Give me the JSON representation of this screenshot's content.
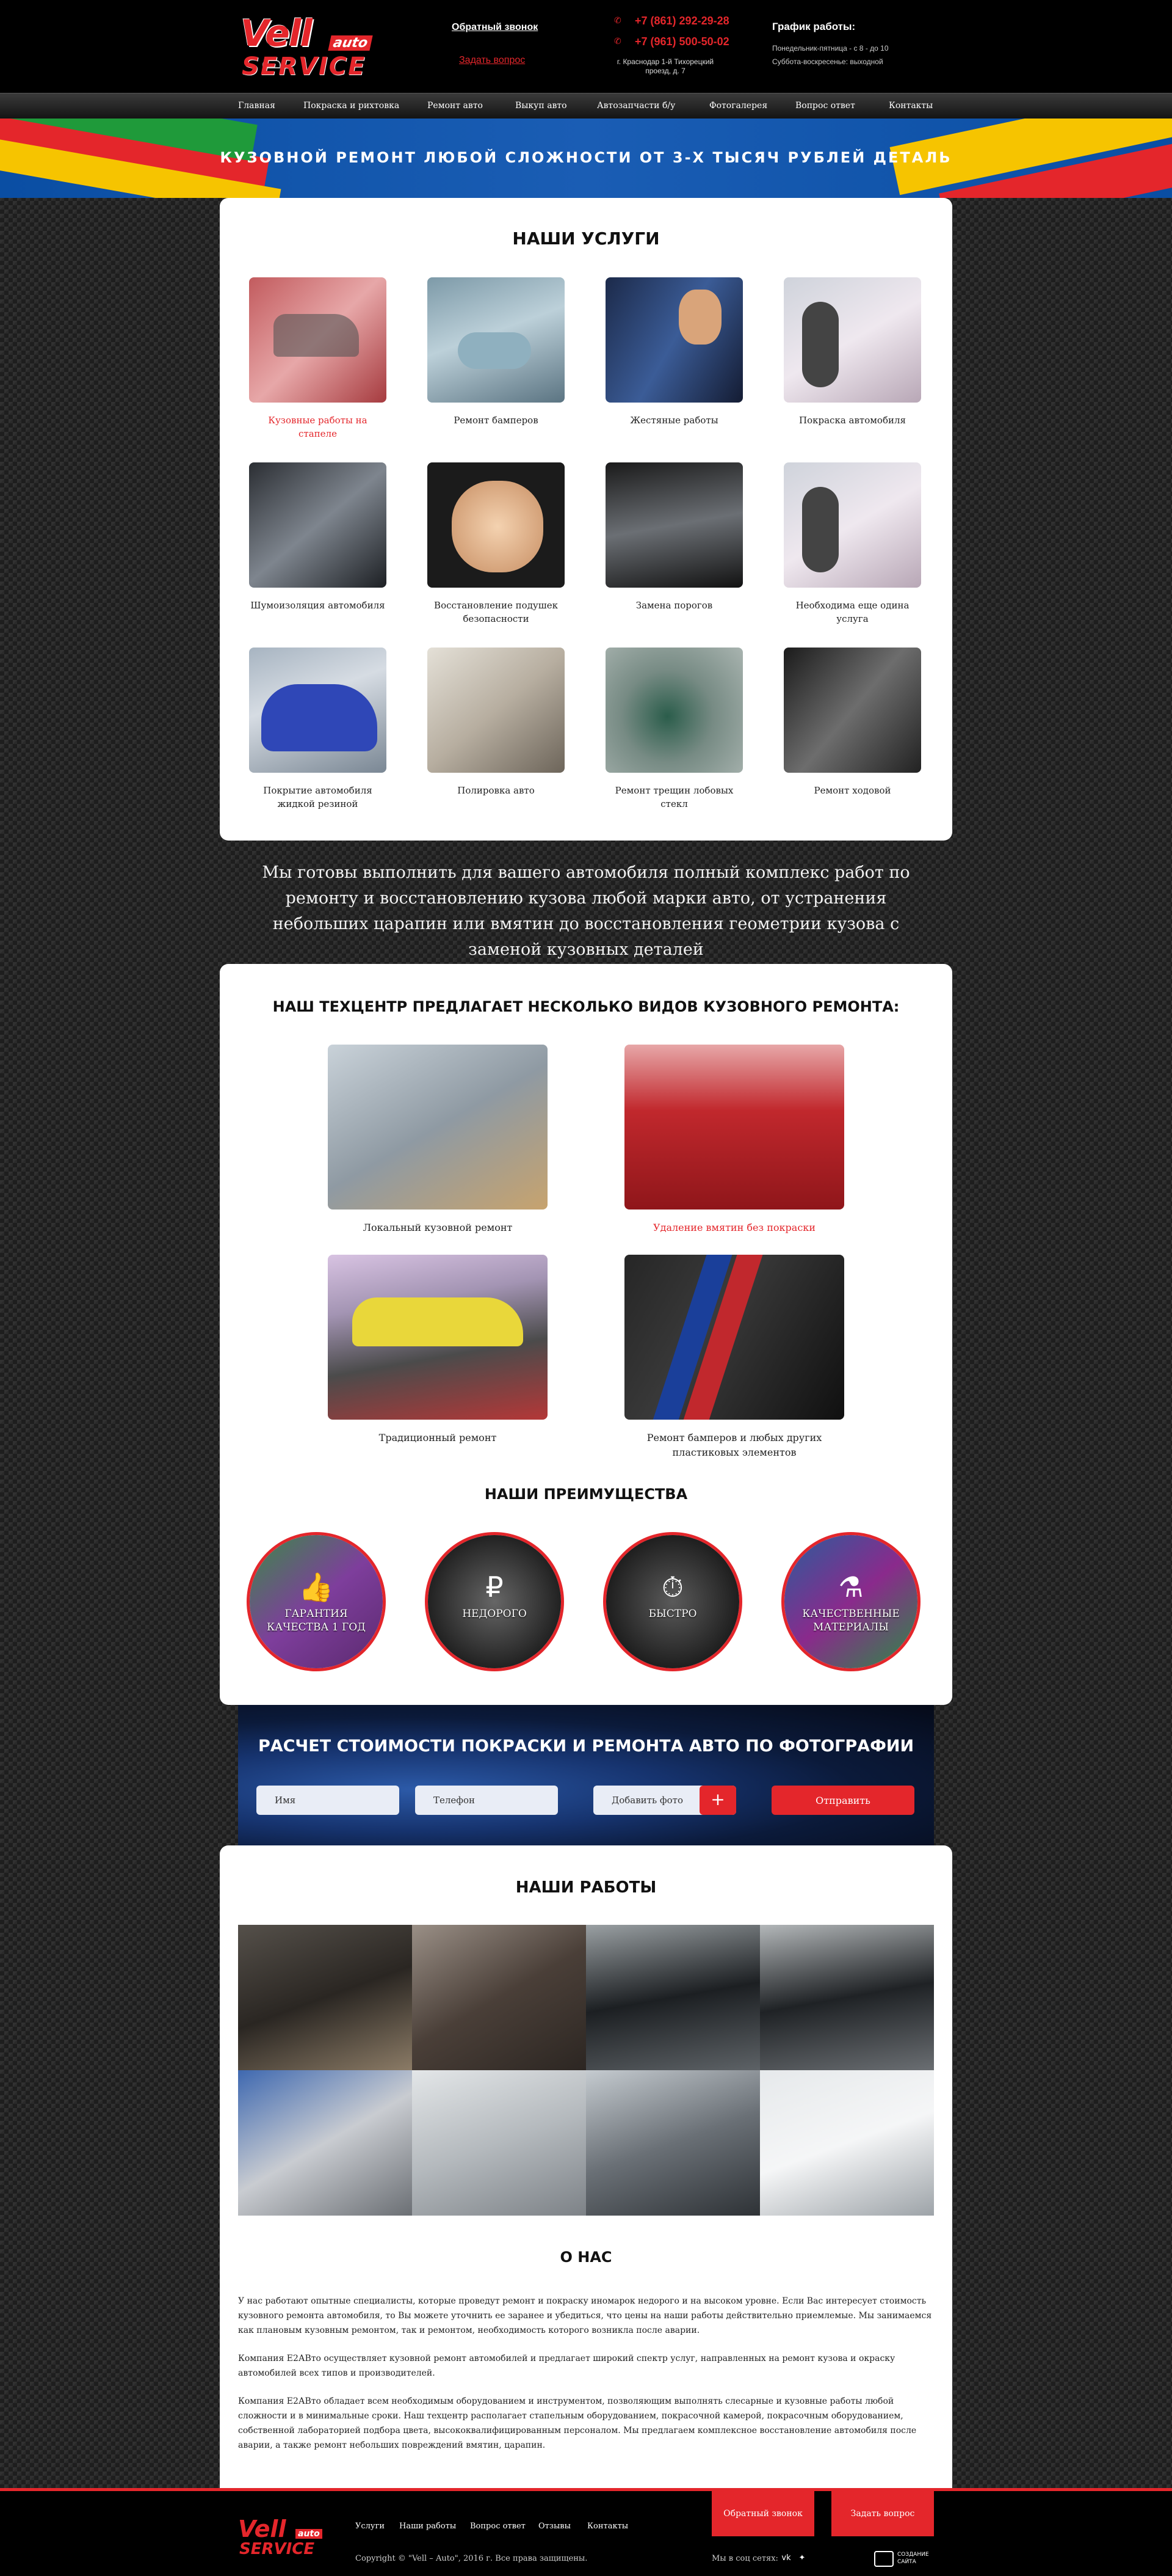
{
  "brand": {
    "vell": "Vell",
    "auto": "auto",
    "service": "SERVICE"
  },
  "header": {
    "callback_label": "Обратный звонок",
    "question_label": "Задать вопрос",
    "phone1": "+7 (861) 292-29-28",
    "phone2": "+7 (961) 500-50-02",
    "address": "г. Краснодар 1-й Тихорецкий проезд, д. 7",
    "schedule_title": "График работы:",
    "schedule_weekdays": "Понедельник-пятница - с 8 - до 10",
    "schedule_weekend": "Суббота-воскресенье: выходной"
  },
  "nav": {
    "items": [
      {
        "label": "Главная"
      },
      {
        "label": "Покраска и рихтовка"
      },
      {
        "label": "Ремонт авто"
      },
      {
        "label": "Выкуп авто"
      },
      {
        "label": "Автозапчасти б/у"
      },
      {
        "label": "Фотогалерея"
      },
      {
        "label": "Вопрос ответ"
      },
      {
        "label": "Контакты"
      }
    ]
  },
  "banner": {
    "text": "КУЗОВНОЙ РЕМОНТ ЛЮБОЙ СЛОЖНОСТИ ОТ 3-Х ТЫСЯЧ РУБЛЕЙ ДЕТАЛЬ"
  },
  "services": {
    "title": "НАШИ УСЛУГИ",
    "items": [
      {
        "label": "Кузовные работы на стапеле",
        "active": true
      },
      {
        "label": "Ремонт бамперов"
      },
      {
        "label": "Жестяные работы"
      },
      {
        "label": "Покраска автомобиля"
      },
      {
        "label": "Шумоизоляция автомобиля"
      },
      {
        "label": "Восстановление подушек безопасности"
      },
      {
        "label": "Замена порогов"
      },
      {
        "label": "Необходима еще одина услуга"
      },
      {
        "label": "Покрытие автомобиля жидкой резиной"
      },
      {
        "label": "Полировка авто"
      },
      {
        "label": "Ремонт трещин лобовых стекл"
      },
      {
        "label": "Ремонт ходовой"
      }
    ]
  },
  "slogan": "Мы готовы выполнить для вашего автомобиля полный комплекс работ по ремонту и восстановлению кузова любой марки авто, от устранения небольших царапин или вмятин до восстановления геометрии кузова с заменой кузовных деталей",
  "repair": {
    "title": "НАШ ТЕХЦЕНТР ПРЕДЛАГАЕТ НЕСКОЛЬКО ВИДОВ КУЗОВНОГО РЕМОНТА:",
    "items": [
      {
        "label": "Локальный кузовной ремонт"
      },
      {
        "label": "Удаление вмятин без покраски",
        "active": true
      },
      {
        "label": "Традиционный ремонт"
      },
      {
        "label": "Ремонт бамперов и любых других пластиковых элементов"
      }
    ]
  },
  "advantages": {
    "title": "НАШИ ПРЕИМУЩЕСТВА",
    "items": [
      {
        "label": "ГАРАНТИЯ КАЧЕСТВА 1 ГОД",
        "icon": "thumbs-up-icon"
      },
      {
        "label": "НЕДОРОГО",
        "icon": "ruble-icon"
      },
      {
        "label": "БЫСТРО",
        "icon": "stopwatch-icon"
      },
      {
        "label": "КАЧЕСТВЕННЫЕ МАТЕРИАЛЫ",
        "icon": "spray-can-icon"
      }
    ]
  },
  "calc": {
    "title": "РАСЧЕТ СТОИМОСТИ ПОКРАСКИ И РЕМОНТА АВТО ПО ФОТОГРАФИИ",
    "name_placeholder": "Имя",
    "phone_placeholder": "Телефон",
    "file_label": "Добавить фото",
    "submit_label": "Отправить"
  },
  "works": {
    "title": "НАШИ РАБОТЫ"
  },
  "about": {
    "title": "О НАС",
    "p1": "У нас работают опытные специалисты, которые проведут ремонт и покраску иномарок недорого и на высоком уровне. Если Вас интересует стоимость кузовного ремонта автомобиля, то Вы можете уточнить ее заранее и убедиться, что цены на наши работы действительно приемлемые. Мы занимаемся как плановым кузовным ремонтом, так и ремонтом, необходимость которого возникла после аварии.",
    "p2": "Компания Е2АВто осуществляет кузовной ремонт автомобилей и предлагает широкий спектр услуг, направленных на ремонт кузова и окраску автомобилей всех типов и производителей.",
    "p3": "Компания Е2АВто обладает всем необходимым оборудованием и инструментом, позволяющим выполнять слесарные и кузовные работы любой сложности и в минимальные сроки. Наш техцентр располагает стапельным оборудованием, покрасочной камерой, покрасочным оборудованием, собственной лабораторией подбора цвета, высококвалифицированным персоналом. Мы предлагаем комплексное восстановление автомобиля после аварии, а также ремонт небольших повреждений вмятин, царапин."
  },
  "footer": {
    "links": [
      {
        "label": "Услуги"
      },
      {
        "label": "Наши работы"
      },
      {
        "label": "Вопрос ответ"
      },
      {
        "label": "Отзывы"
      },
      {
        "label": "Контакты"
      }
    ],
    "callback_label": "Обратный звонок",
    "question_label": "Задать вопрос",
    "copyright": "Copyright © \"Vell – Auto\", 2016 г.  Все права защищены.",
    "social_label": "Мы в соц сетях:",
    "developer": "СОЗДАНИЕ САЙТА"
  },
  "colors": {
    "accent": "#e4262b",
    "dark": "#000000"
  }
}
